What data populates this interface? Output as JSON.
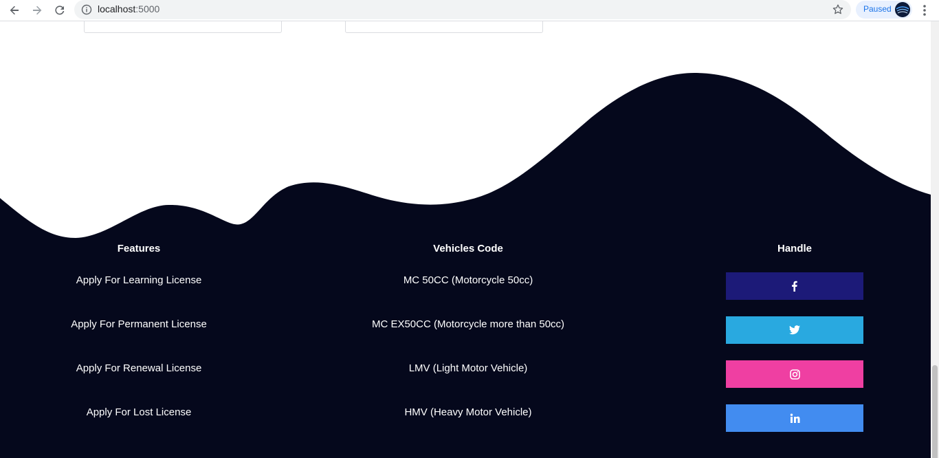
{
  "browser": {
    "url_host": "localhost",
    "url_port": ":5000",
    "profile_status": "Paused"
  },
  "footer": {
    "features": {
      "heading": "Features",
      "items": [
        "Apply For Learning License",
        "Apply For Permanent License",
        "Apply For Renewal License",
        "Apply For Lost License"
      ]
    },
    "vehicles": {
      "heading": "Vehicles Code",
      "items": [
        "MC 50CC (Motorcycle 50cc)",
        "MC EX50CC (Motorcycle more than 50cc)",
        "LMV (Light Motor Vehicle)",
        "HMV (Heavy Motor Vehicle)"
      ]
    },
    "handle": {
      "heading": "Handle",
      "buttons": [
        {
          "icon": "facebook-icon",
          "color": "#1c1a78"
        },
        {
          "icon": "twitter-icon",
          "color": "#29a9e0"
        },
        {
          "icon": "instagram-icon",
          "color": "#ef3fa2"
        },
        {
          "icon": "linkedin-icon",
          "color": "#428cf0"
        }
      ]
    },
    "background_color": "#05081c"
  }
}
